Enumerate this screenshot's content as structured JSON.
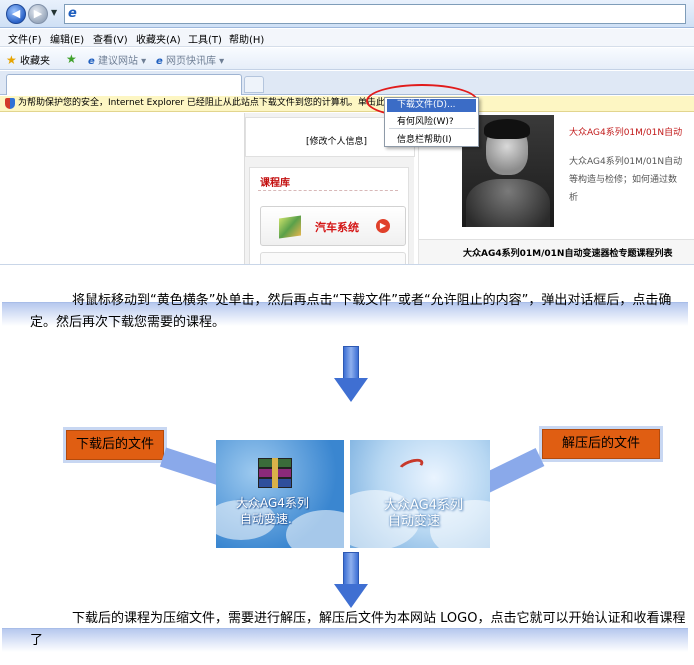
{
  "browser": {
    "menu": [
      "文件(F)",
      "编辑(E)",
      "查看(V)",
      "收藏夹(A)",
      "工具(T)",
      "帮助(H)"
    ],
    "favorites_label": "收藏夹",
    "suggested_sites": "建议网站 ▾",
    "web_slice_gallery": "网页快讯库 ▾",
    "infobar_text": "为帮助保护您的安全，Internet Explorer 已经阻止从此站点下载文件到您的计算机。单击此",
    "context_menu": [
      "下载文件(D)...",
      "有何风险(W)?",
      "信息栏帮助(I)"
    ]
  },
  "page": {
    "profile_link": "[修改个人信息]",
    "course_library": "课程库",
    "car_system": "汽车系统",
    "course_title_red": "大众AG4系列01M/01N自动",
    "course_desc_lines": [
      "大众AG4系列01M/01N自动",
      "等构造与检修；如何通过数",
      "析"
    ],
    "footer_title": "大众AG4系列01M/01N自动变速器检专题课程列表"
  },
  "tutorial": {
    "step1": "将鼠标移动到“黄色横条”处单击，然后再点击“下载文件”或者“允许阻止的内容”，弹出对话框后，点击确定。然后再次下载您需要的课程。",
    "downloaded_label": "下载后的文件",
    "extracted_label": "解压后的文件",
    "thumb1_text": [
      "大众AG4系列",
      "自动变速."
    ],
    "thumb2_text": [
      "大众AG4系列",
      "自动变速"
    ],
    "step2": "下载后的课程为压缩文件，需要进行解压，解压后文件为本网站 LOGO，点击它就可以开始认证和收看课程了"
  },
  "colors": {
    "label_orange": "#e05e12",
    "arrow_blue": "#3f6fd2",
    "highlight_red": "#e11b1b"
  }
}
